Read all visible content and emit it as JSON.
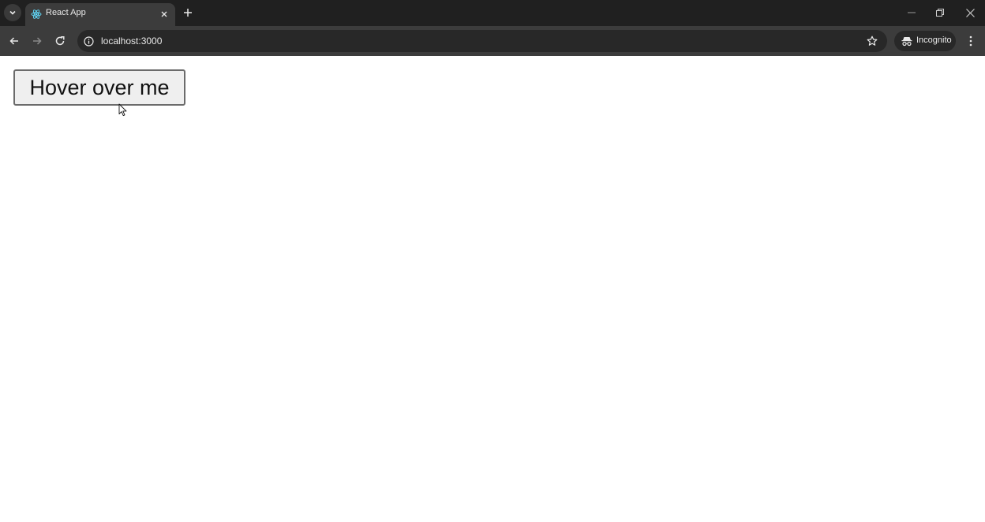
{
  "browser": {
    "tab": {
      "title": "React App"
    },
    "address_bar": {
      "url": "localhost:3000"
    },
    "profile": {
      "label": "Incognito"
    },
    "icons": {
      "tab_search": "chevron-down-icon",
      "favicon": "react-logo-icon",
      "tab_close": "close-icon",
      "new_tab": "plus-icon",
      "minimize": "minimize-icon",
      "restore": "restore-icon",
      "close_window": "close-icon",
      "back": "arrow-left-icon",
      "forward": "arrow-right-icon",
      "reload": "reload-icon",
      "site_info": "info-icon",
      "bookmark": "star-icon",
      "incognito": "incognito-icon",
      "menu": "kebab-menu-icon"
    },
    "colors": {
      "tabstrip": "#202020",
      "toolbar": "#3c3c3c",
      "omnibox": "#282828",
      "react_blue": "#61dafb"
    }
  },
  "page": {
    "button": {
      "label": "Hover over me"
    }
  }
}
